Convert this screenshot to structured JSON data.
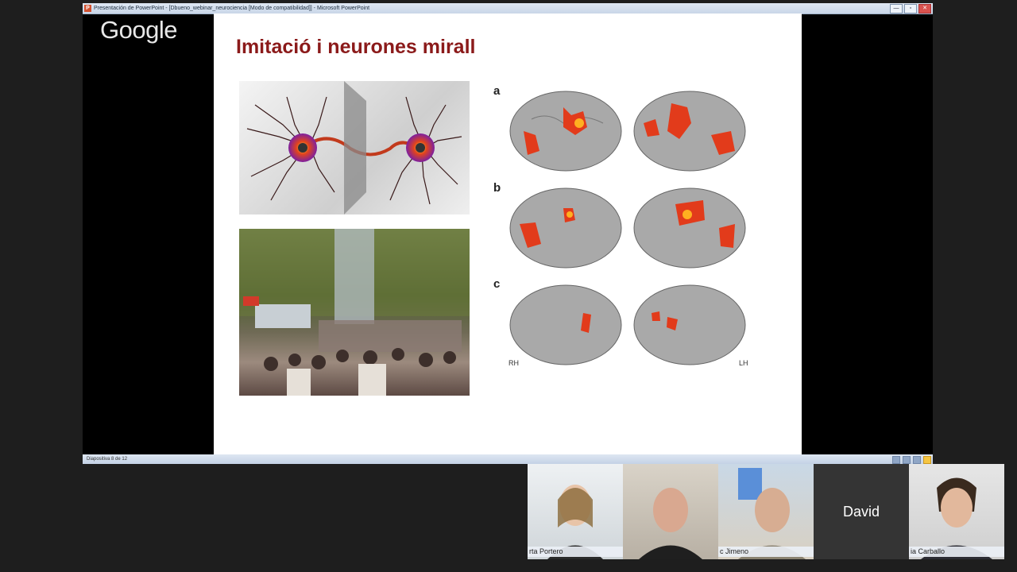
{
  "window": {
    "title": "Presentación de PowerPoint - [Dbueno_webinar_neurociencia [Modo de compatibilidad]] - Microsoft PowerPoint",
    "app_icon": "P",
    "buttons": {
      "minimize": "—",
      "maximize": "▫",
      "close": "✕"
    }
  },
  "overlay": {
    "brand": "Google"
  },
  "slide": {
    "title": "Imitació i neurones mirall",
    "brain_figure": {
      "row_labels": [
        "a",
        "b",
        "c"
      ],
      "left_hemisphere_label": "RH",
      "right_hemisphere_label": "LH"
    }
  },
  "statusbar": {
    "slide_count": "Diapositiva 8 de 12"
  },
  "participants": [
    {
      "name": "rta Portero"
    },
    {
      "name": ""
    },
    {
      "name": "c Jimeno"
    },
    {
      "name": "David"
    },
    {
      "name": "ia Carballo"
    }
  ]
}
